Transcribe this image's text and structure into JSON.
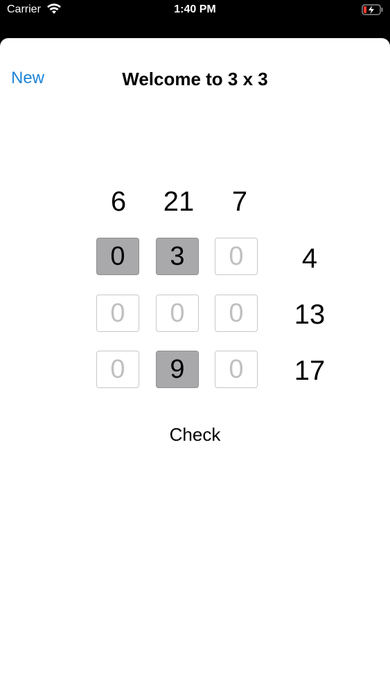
{
  "status_bar": {
    "carrier": "Carrier",
    "time": "1:40 PM",
    "wifi_icon": "wifi-icon",
    "battery_icon": "battery-charging-icon"
  },
  "nav": {
    "new_label": "New",
    "title": "Welcome to 3 x 3",
    "accent_color": "#1e84d6"
  },
  "puzzle": {
    "column_sums": [
      "6",
      "21",
      "7"
    ],
    "row_sums": [
      "4",
      "13",
      "17"
    ],
    "rows": [
      [
        {
          "value": "0",
          "filled": true
        },
        {
          "value": "3",
          "filled": true
        },
        {
          "value": "0",
          "filled": false
        }
      ],
      [
        {
          "value": "0",
          "filled": false
        },
        {
          "value": "0",
          "filled": false
        },
        {
          "value": "0",
          "filled": false
        }
      ],
      [
        {
          "value": "0",
          "filled": false
        },
        {
          "value": "9",
          "filled": true
        },
        {
          "value": "0",
          "filled": false
        }
      ]
    ],
    "filled_color": "#a9a9ab"
  },
  "check_label": "Check"
}
